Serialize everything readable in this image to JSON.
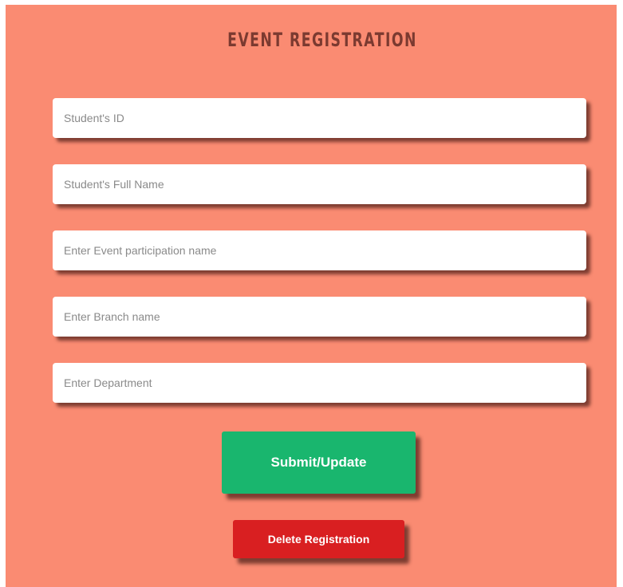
{
  "form": {
    "title": "EVENT REGISTRATION",
    "fields": [
      {
        "placeholder": "Student's ID",
        "value": ""
      },
      {
        "placeholder": "Student's Full Name",
        "value": ""
      },
      {
        "placeholder": "Enter Event participation name",
        "value": ""
      },
      {
        "placeholder": "Enter Branch name",
        "value": ""
      },
      {
        "placeholder": "Enter Department",
        "value": ""
      }
    ],
    "submit_label": "Submit/Update",
    "delete_label": "Delete Registration"
  },
  "colors": {
    "background": "#fa8b72",
    "title": "#7b3a30",
    "submit_button": "#19b66e",
    "delete_button": "#d91f21"
  }
}
